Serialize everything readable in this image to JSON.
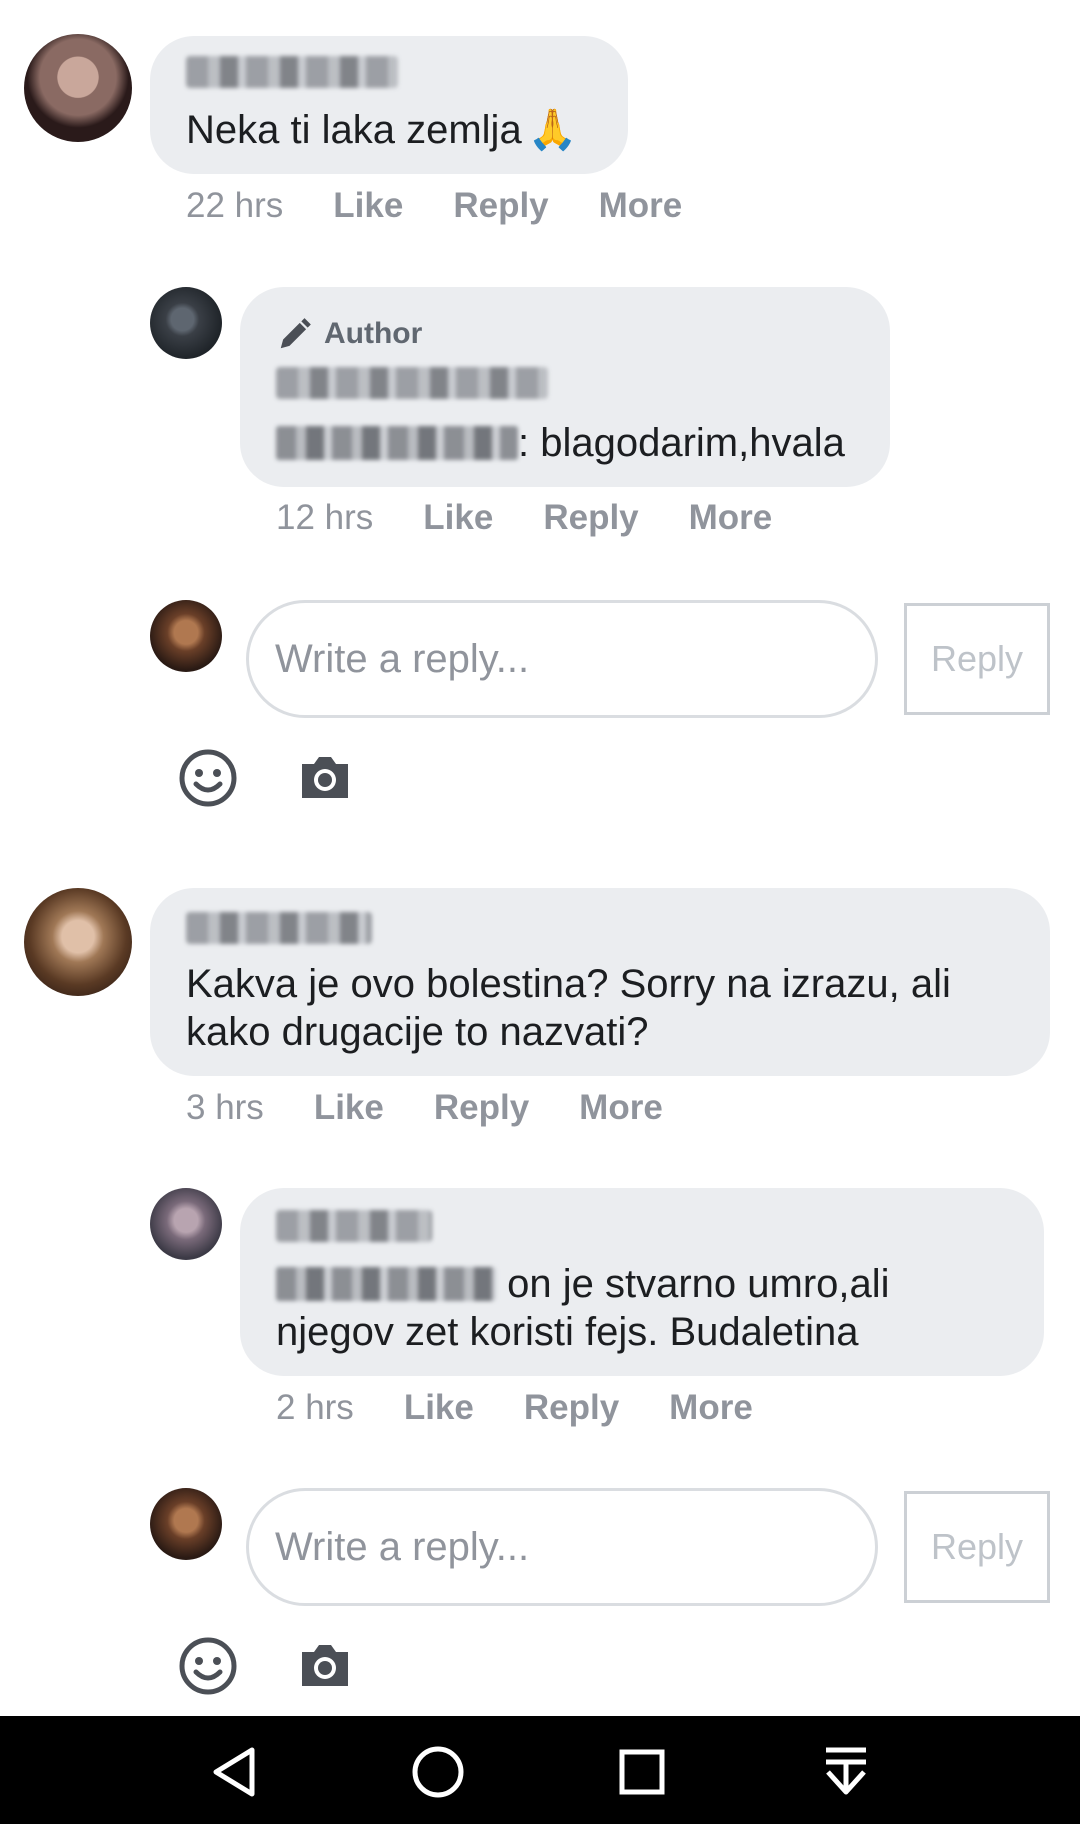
{
  "comments": [
    {
      "author": "Dragan Simić",
      "text": "Neka ti laka zemlja",
      "emoji": "🙏",
      "time": "22 hrs",
      "actions": [
        "Like",
        "Reply",
        "More"
      ],
      "avatar_color": "#4a2e2b"
    },
    {
      "author_badge": "Author",
      "author": "Andrija Petrović",
      "mention": "Dragan Simić",
      "text": ": blagodarim,hvala",
      "time": "12 hrs",
      "actions": [
        "Like",
        "Reply",
        "More"
      ],
      "avatar_color": "#3a3f46"
    },
    {
      "author": "Lili Pobbles",
      "text_line1": "Kakva je ovo bolestina? Sorry na izrazu, ali",
      "text_line2": "kako drugacije to nazvati?",
      "time": "3 hrs",
      "actions": [
        "Like",
        "Reply",
        "More"
      ],
      "avatar_color": "#6b4b36"
    },
    {
      "author": "Igor Ilić",
      "mention": "Lili Pobbles",
      "text_line1": " on je stvarno umro,ali",
      "text_line2": "njegov zet koristi fejs. Budaletina",
      "time": "2 hrs",
      "actions": [
        "Like",
        "Reply",
        "More"
      ],
      "avatar_color": "#6a6470"
    }
  ],
  "composer": {
    "placeholder": "Write a reply...",
    "button_label": "Reply",
    "avatar_color": "#5a3a2a"
  },
  "icons": {
    "emoji": "smiley-icon",
    "camera": "camera-icon",
    "author_badge": "pencil-icon"
  },
  "navbar": {
    "back": "back-icon",
    "home": "home-icon",
    "recents": "recents-icon",
    "notifications": "pull-down-icon"
  },
  "colors": {
    "bubble": "#ebedf0",
    "meta_text": "#90949c",
    "icon_dark": "#4b4f56",
    "navbar": "#000000"
  }
}
